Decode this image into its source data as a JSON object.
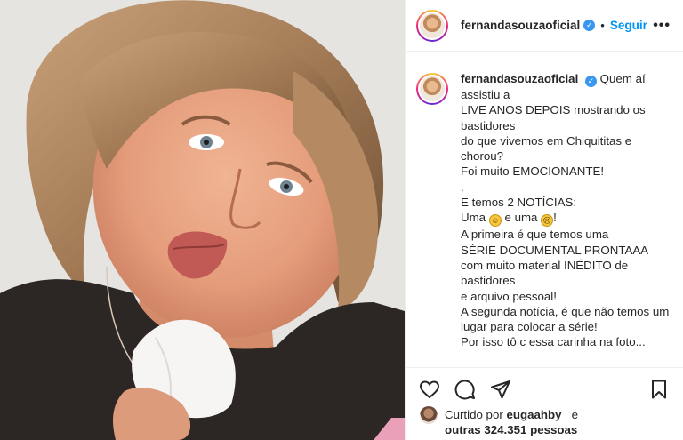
{
  "post": {
    "username": "fernandasouzaoficial",
    "verified_icon": "verified-badge-icon",
    "separator": "•",
    "follow_label": "Seguir",
    "more_label": "•••"
  },
  "caption": {
    "username": "fernandasouzaoficial",
    "lines": [
      "Quem aí assistiu a",
      "LIVE ANOS DEPOIS mostrando os bastidores",
      "do que vivemos em Chiquititas e chorou?",
      "Foi muito EMOCIONANTE!",
      ".",
      "E temos 2 NOTÍCIAS:",
      "Uma",
      "e uma",
      "!",
      "A primeira é que temos uma",
      "SÉRIE DOCUMENTAL PRONTAAA",
      "com muito material INÉDITO de bastidores",
      "e arquivo pessoal!",
      "A segunda notícia, é que não temos um",
      "lugar para colocar a série!",
      "Por isso tô c essa carinha na foto..."
    ],
    "emoji_happy": "☺",
    "emoji_sad": "☹"
  },
  "actions": {
    "like_icon": "heart-icon",
    "comment_icon": "comment-icon",
    "share_icon": "share-icon",
    "save_icon": "bookmark-icon"
  },
  "likes": {
    "prefix": "Curtido por",
    "user": "eugaahby_",
    "connector": "e",
    "others": "outras 324.351 pessoas"
  }
}
